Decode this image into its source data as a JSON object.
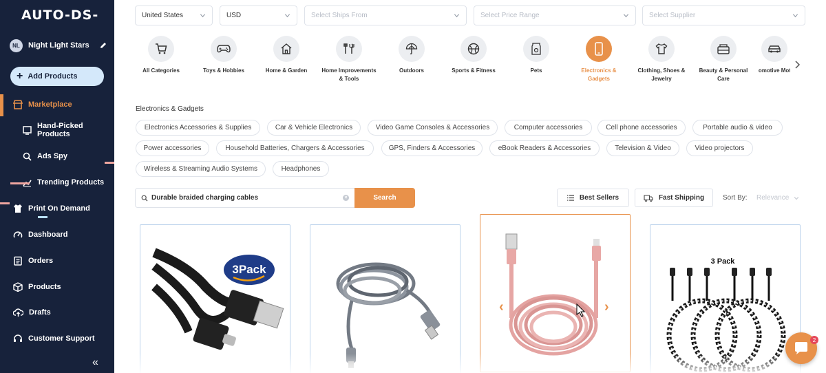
{
  "brand": {
    "logo": "AUTO-DS-",
    "accent": "#e8914a",
    "sidebar_bg": "#17223b"
  },
  "user": {
    "initials": "NL",
    "store_name": "Night Light Stars"
  },
  "sidebar": {
    "add_button": "Add Products",
    "items": [
      {
        "label": "Marketplace",
        "icon": "storefront-icon",
        "active": true
      },
      {
        "label": "Hand-Picked Products",
        "icon": "hand-picked-icon"
      },
      {
        "label": "Ads Spy",
        "icon": "ads-spy-icon"
      },
      {
        "label": "Trending Products",
        "icon": "trending-icon"
      },
      {
        "label": "Print On Demand",
        "icon": "shirt-icon"
      },
      {
        "label": "Dashboard",
        "icon": "gauge-icon"
      },
      {
        "label": "Orders",
        "icon": "clipboard-icon"
      },
      {
        "label": "Products",
        "icon": "box-icon"
      },
      {
        "label": "Drafts",
        "icon": "cloud-upload-icon"
      },
      {
        "label": "Customer Support",
        "icon": "headset-icon"
      }
    ],
    "collapse": "«"
  },
  "filters": {
    "country": "United States",
    "currency": "USD",
    "ships_from_placeholder": "Select Ships From",
    "price_range_placeholder": "Select Price Range",
    "supplier_placeholder": "Select Supplier"
  },
  "categories": [
    {
      "label": "All Categories",
      "icon": "cart-icon"
    },
    {
      "label": "Toys & Hobbies",
      "icon": "gamepad-icon"
    },
    {
      "label": "Home & Garden",
      "icon": "house-icon"
    },
    {
      "label": "Home Improvements & Tools",
      "icon": "tools-icon"
    },
    {
      "label": "Outdoors",
      "icon": "umbrella-icon"
    },
    {
      "label": "Sports & Fitness",
      "icon": "ball-icon"
    },
    {
      "label": "Pets",
      "icon": "pet-food-icon"
    },
    {
      "label": "Electronics & Gadgets",
      "icon": "phone-icon",
      "active": true
    },
    {
      "label": "Clothing, Shoes & Jewelry",
      "icon": "shirt-icon"
    },
    {
      "label": "Beauty & Personal Care",
      "icon": "makeup-icon"
    },
    {
      "label": "Automotive Motors",
      "icon": "car-icon"
    }
  ],
  "subcategory_heading": "Electronics & Gadgets",
  "subcategories": [
    "Electronics Accessories & Supplies",
    "Car & Vehicle Electronics",
    "Video Game Consoles & Accessories",
    "Computer accessories",
    "Cell phone accessories",
    "Portable audio & video",
    "Power accessories",
    "Household Batteries, Chargers & Accessories",
    "GPS, Finders & Accessories",
    "eBook Readers & Accessories",
    "Television & Video",
    "Video projectors",
    "Wireless & Streaming Audio Systems",
    "Headphones"
  ],
  "search": {
    "value": "Durable braided charging cables",
    "button": "Search"
  },
  "toolbar": {
    "best_sellers": "Best Sellers",
    "fast_shipping": "Fast Shipping",
    "sort_label": "Sort By:",
    "sort_value": "Relevance"
  },
  "products": [
    {
      "badge": "3Pack",
      "image": "black-usb-c-cable"
    },
    {
      "image": "grey-braided-lightning-cable"
    },
    {
      "image": "pink-braided-lightning-cable",
      "active": true
    },
    {
      "badge": "3 Pack",
      "image": "black-white-usb-c-cables"
    }
  ],
  "chat": {
    "badge": "2"
  }
}
